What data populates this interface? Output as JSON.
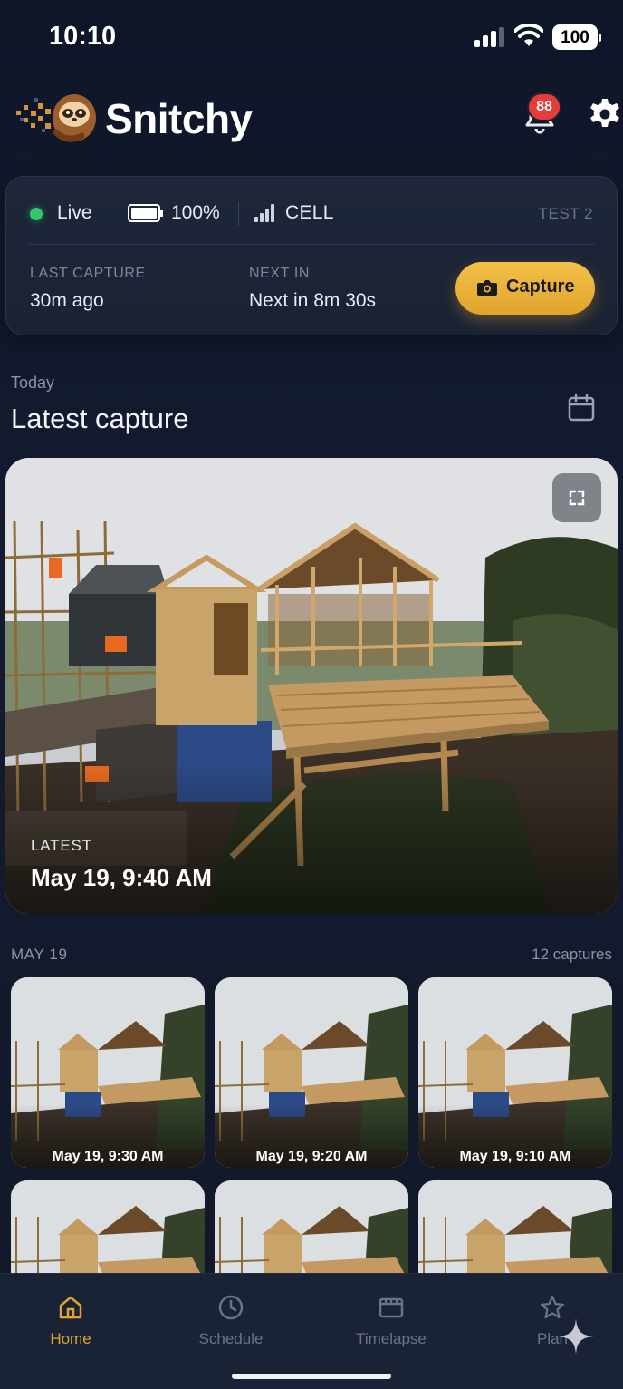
{
  "status_bar": {
    "time": "10:10",
    "battery": "100"
  },
  "header": {
    "brand": "Snitchy",
    "notification_count": "88",
    "icons": [
      "bell-icon",
      "gear-icon"
    ]
  },
  "status_card": {
    "live_label": "Live",
    "battery_label": "100%",
    "battery_level": 1.0,
    "network_label": "CELL",
    "device_name": "TEST 2",
    "last_capture_heading": "LAST CAPTURE",
    "last_capture_value": "30m ago",
    "next_heading": "NEXT IN",
    "next_value": "Next in 8m 30s",
    "capture_button": "Capture"
  },
  "section": {
    "day": "Today",
    "title": "Latest capture"
  },
  "hero": {
    "tag": "LATEST",
    "timestamp": "May 19, 9:40 AM"
  },
  "gallery": {
    "date": "MAY 19",
    "count": "12 captures",
    "items": [
      {
        "timestamp": "May 19, 9:30 AM"
      },
      {
        "timestamp": "May 19, 9:20 AM"
      },
      {
        "timestamp": "May 19, 9:10 AM"
      }
    ]
  },
  "tabs": [
    {
      "label": "Home",
      "icon": "home-icon",
      "active": true
    },
    {
      "label": "Schedule",
      "icon": "clock-icon",
      "active": false
    },
    {
      "label": "Timelapse",
      "icon": "film-icon",
      "active": false
    },
    {
      "label": "Plan",
      "icon": "star-icon",
      "active": false
    }
  ],
  "colors": {
    "accent": "#e0a42c",
    "live": "#34c86c",
    "badge": "#e53b3b",
    "background": "#121a2e"
  }
}
